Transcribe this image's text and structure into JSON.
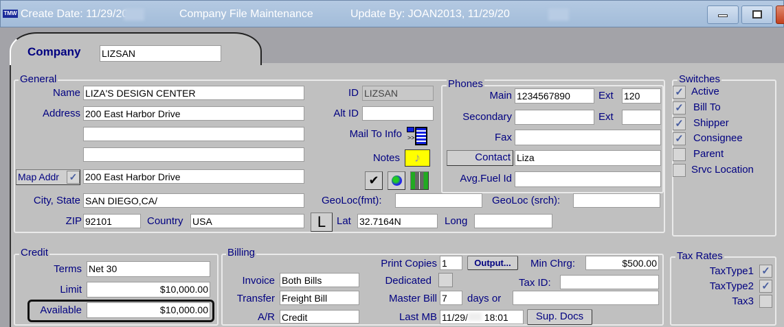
{
  "window": {
    "create_date": "Create Date: 11/29/20",
    "title": "Company File Maintenance",
    "update_by": "Update By: JOAN2013, 11/29/20",
    "app_icon_text": "TMW"
  },
  "company": {
    "label": "Company",
    "value": "LIZSAN"
  },
  "general": {
    "legend": "General",
    "name_label": "Name",
    "name": "LIZA'S DESIGN CENTER",
    "address_label": "Address",
    "address1": "200 East Harbor Drive",
    "address2": "",
    "address3": "",
    "map_addr_label": "Map Addr",
    "map_addr_checked": true,
    "map_address": "200 East Harbor Drive",
    "city_state_label": "City, State",
    "city_state": "SAN DIEGO,CA/",
    "zip_label": "ZIP",
    "zip": "92101",
    "country_label": "Country",
    "country": "USA",
    "id_label": "ID",
    "id": "LIZSAN",
    "alt_id_label": "Alt ID",
    "alt_id": "",
    "mail_to_label": "Mail To Info",
    "notes_label": "Notes",
    "geoloc_fmt_label": "GeoLoc(fmt):",
    "geoloc_fmt": "",
    "geoloc_srch_label": "GeoLoc (srch):",
    "geoloc_srch": "",
    "l_button": "L",
    "lat_label": "Lat",
    "lat": "32.7164N",
    "long_label": "Long",
    "long": ""
  },
  "phones": {
    "legend": "Phones",
    "main_label": "Main",
    "main": "1234567890",
    "ext_label": "Ext",
    "main_ext": "120",
    "secondary_label": "Secondary",
    "secondary": "",
    "secondary_ext": "",
    "fax_label": "Fax",
    "fax": "",
    "contact_label": "Contact",
    "contact": "Liza",
    "fuel_label": "Avg.Fuel Id",
    "fuel": ""
  },
  "switches": {
    "legend": "Switches",
    "items": [
      {
        "label": "Active",
        "checked": true
      },
      {
        "label": "Bill To",
        "checked": true
      },
      {
        "label": "Shipper",
        "checked": true
      },
      {
        "label": "Consignee",
        "checked": true
      },
      {
        "label": "Parent",
        "checked": false
      },
      {
        "label": "Srvc Location",
        "checked": false
      }
    ]
  },
  "credit": {
    "legend": "Credit",
    "terms_label": "Terms",
    "terms": "Net 30",
    "limit_label": "Limit",
    "limit": "$10,000.00",
    "available_label": "Available",
    "available": "$10,000.00"
  },
  "billing": {
    "legend": "Billing",
    "print_copies_label": "Print Copies",
    "print_copies": "1",
    "output_label": "Output...",
    "min_chrg_label": "Min Chrg:",
    "min_chrg": "$500.00",
    "invoice_label": "Invoice",
    "invoice": "Both Bills",
    "dedicated_label": "Dedicated",
    "dedicated": false,
    "tax_id_label": "Tax ID:",
    "tax_id": "",
    "transfer_label": "Transfer",
    "transfer": "Freight Bill",
    "master_bill_label": "Master Bill",
    "master_bill": "7",
    "days_or_label": "days or",
    "days_or": "",
    "ar_label": "A/R",
    "ar": "Credit",
    "last_mb_label": "Last MB",
    "last_mb_date": "11/29/",
    "last_mb_time": "18:01",
    "sup_docs_label": "Sup. Docs"
  },
  "tax_rates": {
    "legend": "Tax Rates",
    "items": [
      {
        "label": "TaxType1",
        "checked": true
      },
      {
        "label": "TaxType2",
        "checked": true
      },
      {
        "label": "Tax3",
        "checked": false
      }
    ]
  },
  "check_glyph": "✓"
}
